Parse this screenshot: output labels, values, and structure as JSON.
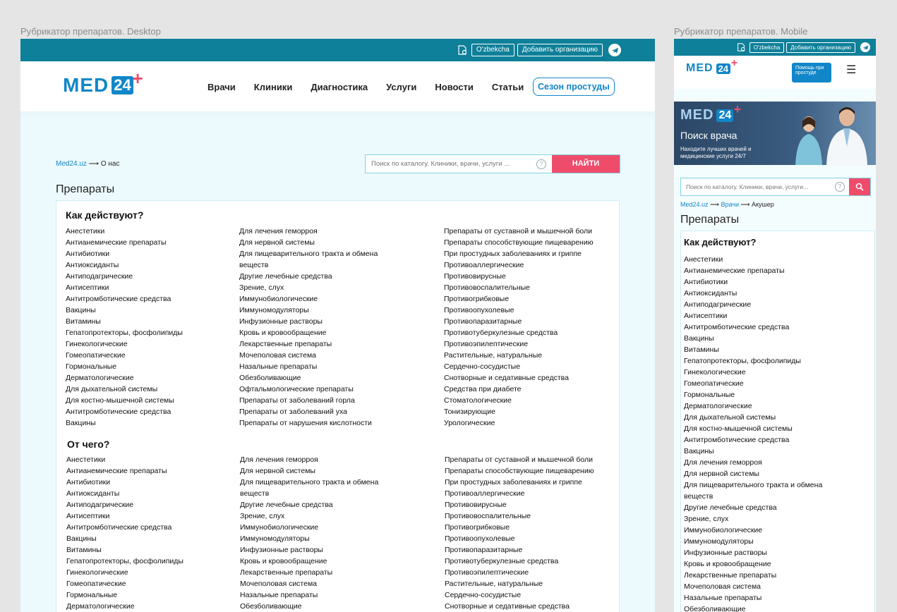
{
  "labels": {
    "desktop": "Рубрикатор препаратов. Desktop",
    "mobile": "Рубрикатор препаратов. Mobile"
  },
  "topbar": {
    "lang": "O'zbekcha",
    "add_org": "Добавить организацию"
  },
  "logo": {
    "text": "MED",
    "num": "24",
    "plus": "+"
  },
  "nav": [
    "Врачи",
    "Клиники",
    "Диагностика",
    "Услуги",
    "Новости",
    "Статьи"
  ],
  "season": "Сезон простуды",
  "breadcrumb": {
    "home": "Med24.uz",
    "arrow": "⟶",
    "current": "О нас"
  },
  "search": {
    "placeholder": "Поиск по каталогу. Клиники, врачи, услуги ...",
    "button": "НАЙТИ"
  },
  "page_title": "Препараты",
  "sections": [
    {
      "title": "Как действуют?",
      "col1": [
        "Анестетики",
        "Антианемические препараты",
        "Антибиотики",
        "Антиоксиданты",
        "Антиподагрические",
        "Антисептики",
        "Антитромботические средства",
        "Вакцины",
        "Витамины",
        "Гепатопротекторы, фосфолипиды",
        "Гинекологические",
        "Гомеопатические",
        "Гормональные",
        "Дерматологические",
        "Для дыхательной системы",
        "Для костно-мышечной системы",
        "Антитромботические средства",
        "Вакцины"
      ],
      "col2": [
        "Для лечения геморроя",
        "Для нервной системы",
        "Для пищеварительного тракта и обмена веществ",
        "Другие лечебные средства",
        "Зрение, слух",
        "Иммунобиологические",
        "Иммуномодуляторы",
        "Инфузионные растворы",
        "Кровь и кровообращение",
        "Лекарственные препараты",
        "Мочеполовая система",
        "Назальные препараты",
        "Обезболивающие",
        "Офтальмологические препараты",
        "Препараты от заболеваний горла",
        "Препараты от заболеваний уха",
        "Препараты от нарушения кислотности"
      ],
      "col3": [
        "Препараты от суставной и мышечной боли",
        "Препараты способствующие пищеварению",
        "При простудных заболеваниях и гриппе",
        "Противоаллергические",
        "Противовирусные",
        "Противовоспалительные",
        "Противогрибковые",
        "Противоопухолевые",
        "Противопаразитарные",
        "Противотуберкулезные средства",
        "Противоэпилептические",
        "Растительные, натуральные",
        "Сердечно-сосудистые",
        "Снотворные и седативные средства",
        "Средства при диабете",
        "Стоматологические",
        "Тонизирующие",
        "Урологические"
      ]
    },
    {
      "title": "От чего?",
      "col1": [
        "Анестетики",
        "Антианемические препараты",
        "Антибиотики",
        "Антиоксиданты",
        "Антиподагрические",
        "Антисептики",
        "Антитромботические средства",
        "Вакцины",
        "Витамины",
        "Гепатопротекторы, фосфолипиды",
        "Гинекологические",
        "Гомеопатические",
        "Гормональные",
        "Дерматологические"
      ],
      "col2": [
        "Для лечения геморроя",
        "Для нервной системы",
        "Для пищеварительного тракта и обмена веществ",
        "Другие лечебные средства",
        "Зрение, слух",
        "Иммунобиологические",
        "Иммуномодуляторы",
        "Инфузионные растворы",
        "Кровь и кровообращение",
        "Лекарственные препараты",
        "Мочеполовая система",
        "Назальные препараты",
        "Обезболивающие"
      ],
      "col3": [
        "Препараты от суставной и мышечной боли",
        "Препараты способствующие пищеварению",
        "При простудных заболеваниях и гриппе",
        "Противоаллергические",
        "Противовирусные",
        "Противовоспалительные",
        "Противогрибковые",
        "Противоопухолевые",
        "Противопаразитарные",
        "Противотуберкулезные средства",
        "Противоэпилептические",
        "Растительные, натуральные",
        "Сердечно-сосудистые",
        "Снотворные и седативные средства"
      ]
    }
  ],
  "mobile": {
    "help": "Помощь при простуде",
    "banner_title": "Поиск врача",
    "banner_sub": "Находите лучших врачей и медицинские услуги 24/7",
    "search_placeholder": "Поиск по каталогу. Клиники, врачи, услуги...",
    "breadcrumb": {
      "home": "Med24.uz",
      "mid": "Врачи",
      "current": "Акушер"
    },
    "section_title": "Как действуют?",
    "items": [
      "Анестетики",
      "Антианемические препараты",
      "Антибиотики",
      "Антиоксиданты",
      "Антиподагрические",
      "Антисептики",
      "Антитромботические средства",
      "Вакцины",
      "Витамины",
      "Гепатопротекторы, фосфолипиды",
      "Гинекологические",
      "Гомеопатические",
      "Гормональные",
      "Дерматологические",
      "Для дыхательной системы",
      "Для костно-мышечной системы",
      "Антитромботические средства",
      "Вакцины",
      "Для лечения геморроя",
      "Для нервной системы",
      "Для пищеварительного тракта и обмена веществ",
      "Другие лечебные средства",
      "Зрение, слух",
      "Иммунобиологические",
      "Иммуномодуляторы",
      "Инфузионные растворы",
      "Кровь и кровообращение",
      "Лекарственные препараты",
      "Мочеполовая система",
      "Назальные препараты",
      "Обезболивающие"
    ]
  },
  "colors": {
    "teal": "#0e8099",
    "brand": "#1186c9",
    "accent": "#ef4c6c"
  }
}
